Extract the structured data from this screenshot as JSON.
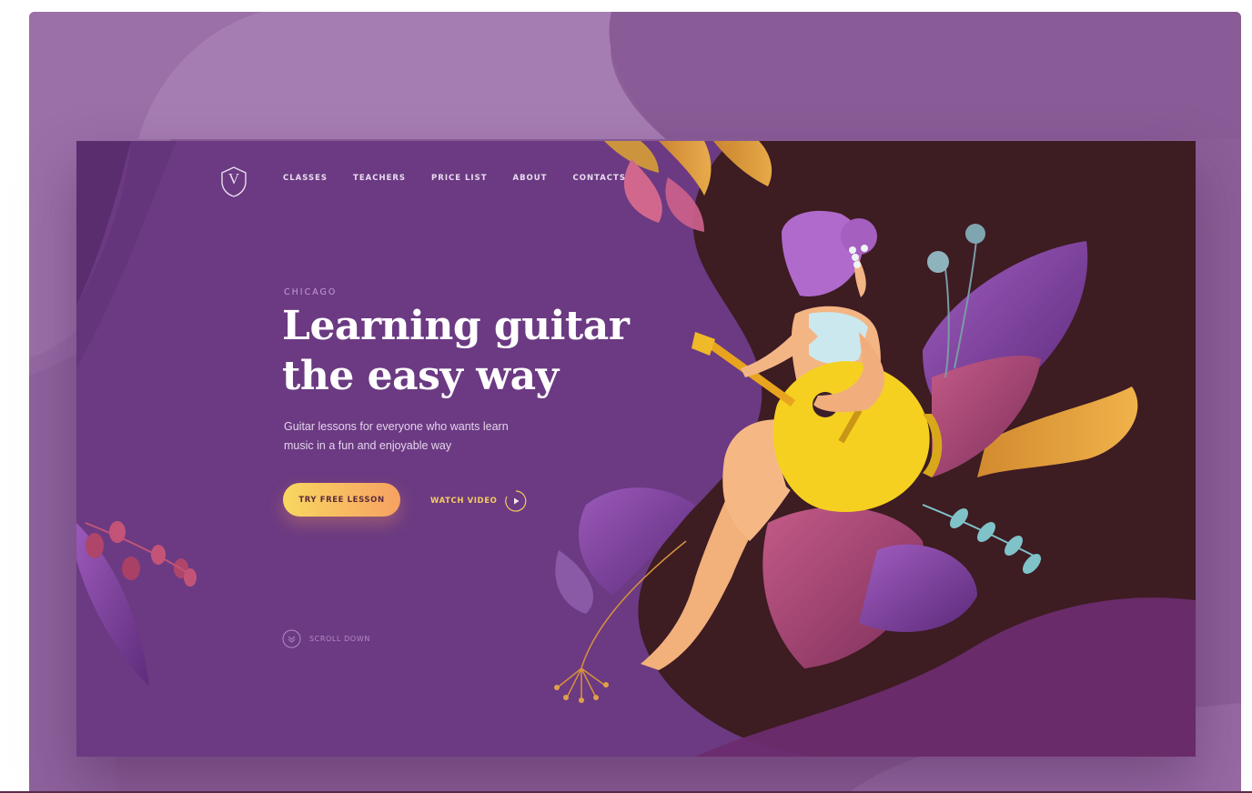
{
  "nav": {
    "logo_letter": "V",
    "items": [
      {
        "label": "CLASSES"
      },
      {
        "label": "TEACHERS"
      },
      {
        "label": "PRICE LIST"
      },
      {
        "label": "ABOUT"
      },
      {
        "label": "CONTACTS"
      }
    ]
  },
  "hero": {
    "kicker": "CHICAGO",
    "title_line1": "Learning guitar",
    "title_line2": "the easy way",
    "subtitle_line1": "Guitar lessons for everyone who wants learn",
    "subtitle_line2": "music in a fun and enjoyable way",
    "cta_label": "TRY FREE LESSON",
    "watch_label": "WATCH VIDEO",
    "scroll_label": "SCROLL DOWN"
  },
  "icons": {
    "logo": "shield-v-logo-icon",
    "play": "play-circle-icon",
    "scroll": "chevron-double-down-circle-icon"
  },
  "colors": {
    "frame": "#8d5f99",
    "hero_bg": "#6b3a82",
    "dark_panel": "#3d1c22",
    "accent_yellow": "#f8d760",
    "accent_orange": "#f7a162",
    "guitar": "#f5d020"
  }
}
